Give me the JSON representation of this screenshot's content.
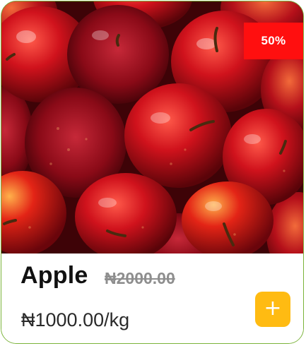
{
  "product": {
    "name": "Apple",
    "original_price": "₦2000.00",
    "price": "₦1000.00/kg",
    "discount_badge": "50%",
    "image": "apples-photo",
    "add_icon": "+"
  },
  "colors": {
    "border": "#7bb33a",
    "badge": "#ff0f0f",
    "add_button": "#ffbb12",
    "apple_red": "#c8101e"
  }
}
